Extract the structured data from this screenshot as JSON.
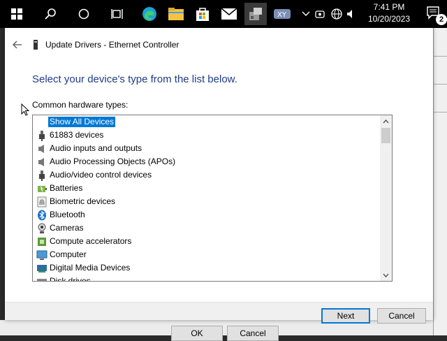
{
  "taskbar": {
    "time": "7:41 PM",
    "date": "10/20/2023",
    "notification_count": "2",
    "icons": [
      "windows-start-icon",
      "search-icon",
      "cortana-icon",
      "task-view-icon",
      "edge-icon",
      "file-explorer-icon",
      "store-icon",
      "mail-icon",
      "device-manager-icon",
      "app-icon",
      "chevron-up-icon",
      "camera-icon",
      "network-icon",
      "volume-icon",
      "notification-icon"
    ]
  },
  "dialog": {
    "title": "Update Drivers - Ethernet Controller",
    "heading": "Select your device's type from the list below.",
    "list_label": "Common hardware types:",
    "items": [
      {
        "label": "Show All Devices",
        "icon": "none",
        "selected": true
      },
      {
        "label": "61883 devices",
        "icon": "connector-icon"
      },
      {
        "label": "Audio inputs and outputs",
        "icon": "speaker-icon"
      },
      {
        "label": "Audio Processing Objects (APOs)",
        "icon": "speaker-icon"
      },
      {
        "label": "Audio/video control devices",
        "icon": "connector-icon"
      },
      {
        "label": "Batteries",
        "icon": "battery-icon"
      },
      {
        "label": "Biometric devices",
        "icon": "fingerprint-icon"
      },
      {
        "label": "Bluetooth",
        "icon": "bluetooth-icon"
      },
      {
        "label": "Cameras",
        "icon": "camera-icon"
      },
      {
        "label": "Compute accelerators",
        "icon": "chip-icon"
      },
      {
        "label": "Computer",
        "icon": "monitor-icon"
      },
      {
        "label": "Digital Media Devices",
        "icon": "media-device-icon"
      },
      {
        "label": "Disk drives",
        "icon": "disk-icon"
      }
    ],
    "next_label": "Next",
    "cancel_label": "Cancel"
  },
  "background": {
    "ok_label": "OK",
    "cancel_label": "Cancel"
  },
  "colors": {
    "selection": "#0078d7",
    "heading": "#1f3c88"
  }
}
